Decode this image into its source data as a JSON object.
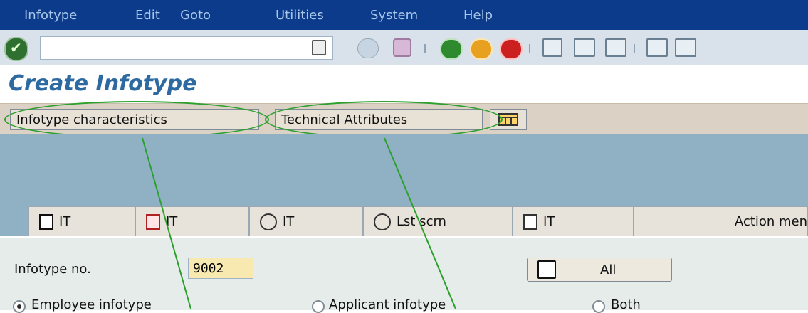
{
  "menu": [
    {
      "label": "Infotype"
    },
    {
      "label": "Edit"
    },
    {
      "label": "Goto"
    },
    {
      "label": "Utilities"
    },
    {
      "label": "System"
    },
    {
      "label": "Help"
    }
  ],
  "toolbar": {
    "icons": [
      "check-icon",
      "command-field-menu-icon",
      "back-arrow-icon",
      "save-icon",
      "back-icon",
      "exit-icon",
      "cancel-icon",
      "print-icon",
      "find-icon",
      "find-next-icon",
      "first-page-icon",
      "previous-page-icon"
    ]
  },
  "page": {
    "title": "Create Infotype"
  },
  "app_toolbar": {
    "infotype_characteristics": "Infotype characteristics",
    "technical_attributes": "Technical Attributes"
  },
  "tabs": [
    {
      "label": "IT",
      "icon": "new-document-icon"
    },
    {
      "label": "IT",
      "icon": "copy-icon"
    },
    {
      "label": "IT",
      "icon": "spiral-icon"
    },
    {
      "label": "Lst scrn",
      "icon": "spiral-icon"
    },
    {
      "label": "IT",
      "icon": "trash-icon"
    },
    {
      "label": "Action men",
      "icon": ""
    }
  ],
  "form": {
    "infotype_no_label": "Infotype no.",
    "infotype_no_value": "9002",
    "all_button": "All",
    "radios": [
      {
        "label": "Employee infotype",
        "selected": true
      },
      {
        "label": "Applicant infotype",
        "selected": false
      },
      {
        "label": "Both",
        "selected": false
      }
    ]
  },
  "colors": {
    "menubar": "#0b3b8a",
    "title": "#2e6aa2",
    "annotation": "#2ca02c"
  }
}
